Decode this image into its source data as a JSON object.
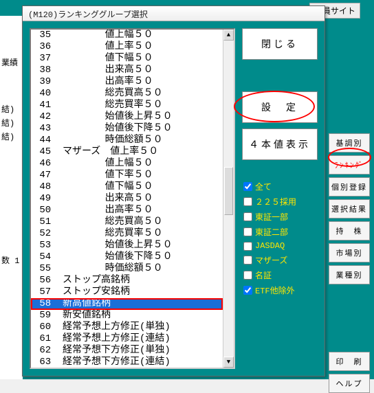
{
  "dialog": {
    "title": "(M120)ランキンググループ選択"
  },
  "buttons": {
    "close": "閉じる",
    "settei": "設　定",
    "yon": "４本値表示"
  },
  "side": {
    "kichou": "基調別",
    "ranking": "ﾗﾝｷﾝｸﾞ",
    "kobetsu": "個別登録",
    "sentaku": "選択結果",
    "mochikabu": "持　株",
    "shijo": "市場別",
    "gyoushu": "業種別",
    "insatsu": "印　刷",
    "help": "ヘルプ"
  },
  "checks": {
    "all": {
      "label": "全て",
      "checked": true
    },
    "c225": {
      "label": "２２５採用",
      "checked": false
    },
    "t1": {
      "label": "東証一部",
      "checked": false
    },
    "t2": {
      "label": "東証二部",
      "checked": false
    },
    "jq": {
      "label": "JASDAQ",
      "checked": false
    },
    "mz": {
      "label": "マザーズ",
      "checked": false
    },
    "ms": {
      "label": "名証",
      "checked": false
    },
    "etf": {
      "label": "ETF他除外",
      "checked": true
    }
  },
  "left": {
    "gyouseki": "業績",
    "k1": "結)",
    "k2": "結)",
    "k3": "結)",
    "kazu": "数 1"
  },
  "top": {
    "kaiin": "会員サイト"
  },
  "list": [
    {
      "n": "35",
      "t": "値上幅５０"
    },
    {
      "n": "36",
      "t": "値上率５０"
    },
    {
      "n": "37",
      "t": "値下幅５０"
    },
    {
      "n": "38",
      "t": "出来高５０"
    },
    {
      "n": "39",
      "t": "出高率５０"
    },
    {
      "n": "40",
      "t": "総売買高５０"
    },
    {
      "n": "41",
      "t": "総売買率５０"
    },
    {
      "n": "42",
      "t": "始値後上昇５０"
    },
    {
      "n": "43",
      "t": "始値後下降５０"
    },
    {
      "n": "44",
      "t": "時価総額５０"
    },
    {
      "n": "45",
      "t": "マザーズ　値上率５０",
      "pad": false
    },
    {
      "n": "46",
      "t": "値上幅５０"
    },
    {
      "n": "47",
      "t": "値下率５０"
    },
    {
      "n": "48",
      "t": "値下幅５０"
    },
    {
      "n": "49",
      "t": "出来高５０"
    },
    {
      "n": "50",
      "t": "出高率５０"
    },
    {
      "n": "51",
      "t": "総売買高５０"
    },
    {
      "n": "52",
      "t": "総売買率５０"
    },
    {
      "n": "53",
      "t": "始値後上昇５０"
    },
    {
      "n": "54",
      "t": "始値後下降５０"
    },
    {
      "n": "55",
      "t": "時価総額５０"
    },
    {
      "n": "56",
      "t": "ストップ高銘柄",
      "pad": false
    },
    {
      "n": "57",
      "t": "ストップ安銘柄",
      "pad": false
    },
    {
      "n": "58",
      "t": "新高値銘柄",
      "pad": false,
      "sel": true,
      "hl": true
    },
    {
      "n": "59",
      "t": "新安値銘柄",
      "pad": false
    },
    {
      "n": "60",
      "t": "経常予想上方修正(単独)",
      "pad": false
    },
    {
      "n": "61",
      "t": "経常予想上方修正(連結)",
      "pad": false
    },
    {
      "n": "62",
      "t": "経常予想下方修正(単独)",
      "pad": false
    },
    {
      "n": "63",
      "t": "経常予想下方修正(連結)",
      "pad": false
    }
  ]
}
